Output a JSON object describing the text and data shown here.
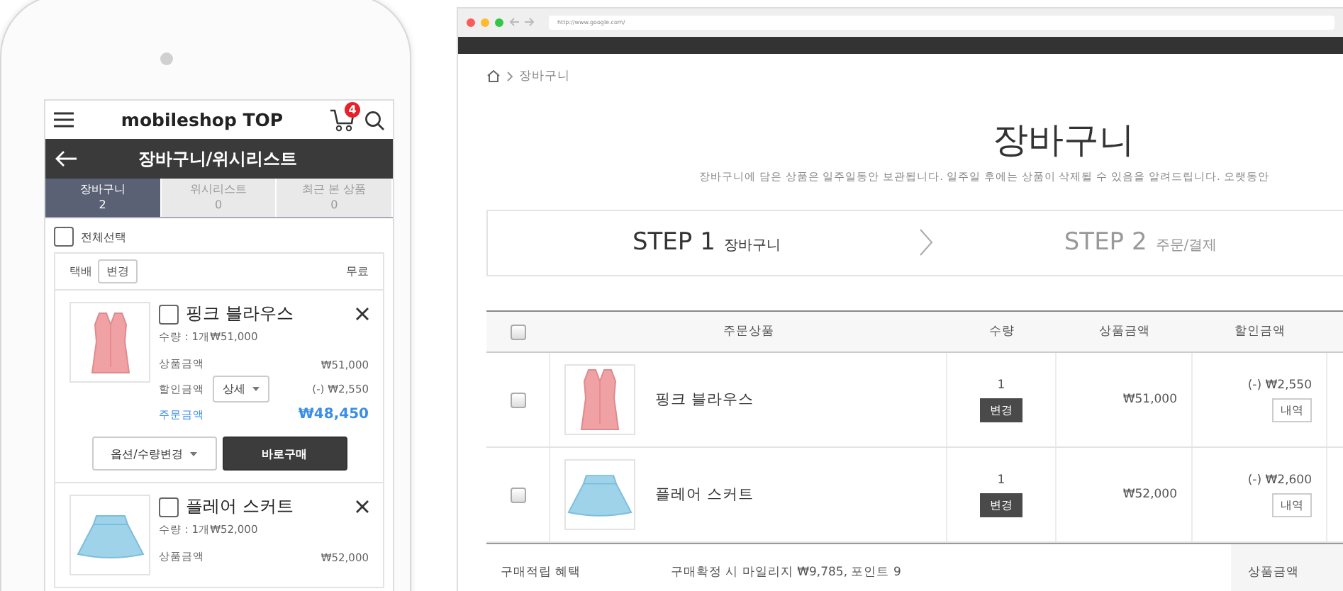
{
  "phone": {
    "header": {
      "title": "mobileshop TOP",
      "cart_count": "4"
    },
    "subheader": {
      "title": "장바구니/위시리스트"
    },
    "tabs": [
      {
        "label": "장바구니",
        "count": "2",
        "selected": true
      },
      {
        "label": "위시리스트",
        "count": "0",
        "selected": false
      },
      {
        "label": "최근 본 상품",
        "count": "0",
        "selected": false
      }
    ],
    "select_all": {
      "label": "전체선택",
      "checked": false
    },
    "shipping": {
      "label": "택배",
      "button": "변경",
      "fee": "무료"
    },
    "items": [
      {
        "kind": "blouse",
        "name": "핑크 블라우스",
        "checked": false,
        "quantity": "수량 : 1개₩51,000",
        "product_label": "상품금액",
        "product_price": "₩51,000",
        "discount_label": "할인금액",
        "discount_button": "상세",
        "discount": "(-) ₩2,550",
        "order_label": "주문금액",
        "order_price": "₩48,450",
        "option_button": "옵션/수량변경",
        "buy_button": "바로구매"
      },
      {
        "kind": "skirt",
        "name": "플레어 스커트",
        "checked": false,
        "quantity": "수량 : 1개₩52,000",
        "product_label": "상품금액",
        "product_price": "₩52,000"
      }
    ]
  },
  "browser": {
    "url": "http://www.google.com/",
    "breadcrumb": "장바구니",
    "title": "장바구니",
    "notice": "장바구니에 담은 상품은 일주일동안 보관됩니다. 일주일 후에는 상품이 삭제될 수 있음을 알려드립니다. 오랫동안",
    "steps": [
      {
        "step": "STEP 1",
        "label": "장바구니",
        "selected": true
      },
      {
        "step": "STEP 2",
        "label": "주문/결제",
        "selected": false
      }
    ],
    "table": {
      "select_all_checked": false,
      "columns": [
        "주문상품",
        "수량",
        "상품금액",
        "할인금액"
      ],
      "rows": [
        {
          "kind": "blouse",
          "checked": false,
          "name": "핑크 블라우스",
          "quantity": "1",
          "change_button": "변경",
          "price": "₩51,000",
          "discount": "(-) ₩2,550",
          "detail_button": "내역"
        },
        {
          "kind": "skirt",
          "checked": false,
          "name": "플레어 스커트",
          "quantity": "1",
          "change_button": "변경",
          "price": "₩52,000",
          "discount": "(-) ₩2,600",
          "detail_button": "내역"
        }
      ]
    },
    "benefit": {
      "label": "구매적립 혜택",
      "text": "구매확정 시 마일리지 ₩9,785, 포인트 9"
    },
    "summary_label": "상품금액"
  }
}
